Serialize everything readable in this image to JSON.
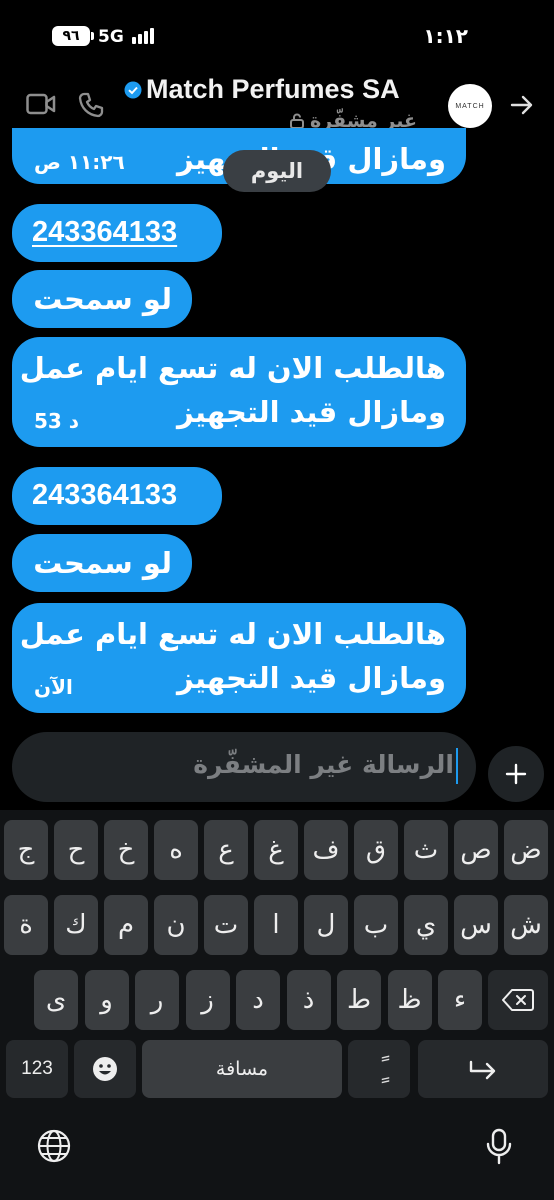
{
  "status_bar": {
    "battery": "٩٦",
    "network": "5G",
    "time": "١:١٢"
  },
  "header": {
    "title": "Match Perfumes SA",
    "subtitle": "غير مشفّرة",
    "avatar_text": "MATCH"
  },
  "day_separator": "اليوم",
  "messages": [
    {
      "type": "text",
      "lines": [
        "ومازال قيد التجهيز"
      ],
      "time": "١١:٢٦ ص"
    },
    {
      "type": "number",
      "text": "243364133",
      "underlined": true
    },
    {
      "type": "text",
      "lines": [
        "لو سمحت"
      ]
    },
    {
      "type": "text",
      "lines": [
        "هالطلب الان له تسع ايام عمل",
        "ومازال قيد التجهيز"
      ],
      "time": "53 د"
    },
    {
      "type": "number",
      "text": "243364133",
      "underlined": false
    },
    {
      "type": "text",
      "lines": [
        "لو سمحت"
      ]
    },
    {
      "type": "text",
      "lines": [
        "هالطلب الان له تسع ايام عمل",
        "ومازال قيد التجهيز"
      ],
      "time": "الآن"
    }
  ],
  "composer": {
    "placeholder": "الرسالة غير المشفّرة"
  },
  "keyboard": {
    "row1": [
      "ض",
      "ص",
      "ث",
      "ق",
      "ف",
      "غ",
      "ع",
      "ه",
      "خ",
      "ح",
      "ج"
    ],
    "row2": [
      "ش",
      "س",
      "ي",
      "ب",
      "ل",
      "ا",
      "ت",
      "ن",
      "م",
      "ك",
      "ة"
    ],
    "row3": [
      "ء",
      "ظ",
      "ط",
      "ذ",
      "د",
      "ز",
      "ر",
      "و",
      "ى"
    ],
    "numbers_label": "123",
    "space_label": "مسافة",
    "tanween_label": "ًٍ"
  },
  "colors": {
    "bubble": "#1d9bf0",
    "background": "#000000",
    "key": "#3a3d40"
  }
}
